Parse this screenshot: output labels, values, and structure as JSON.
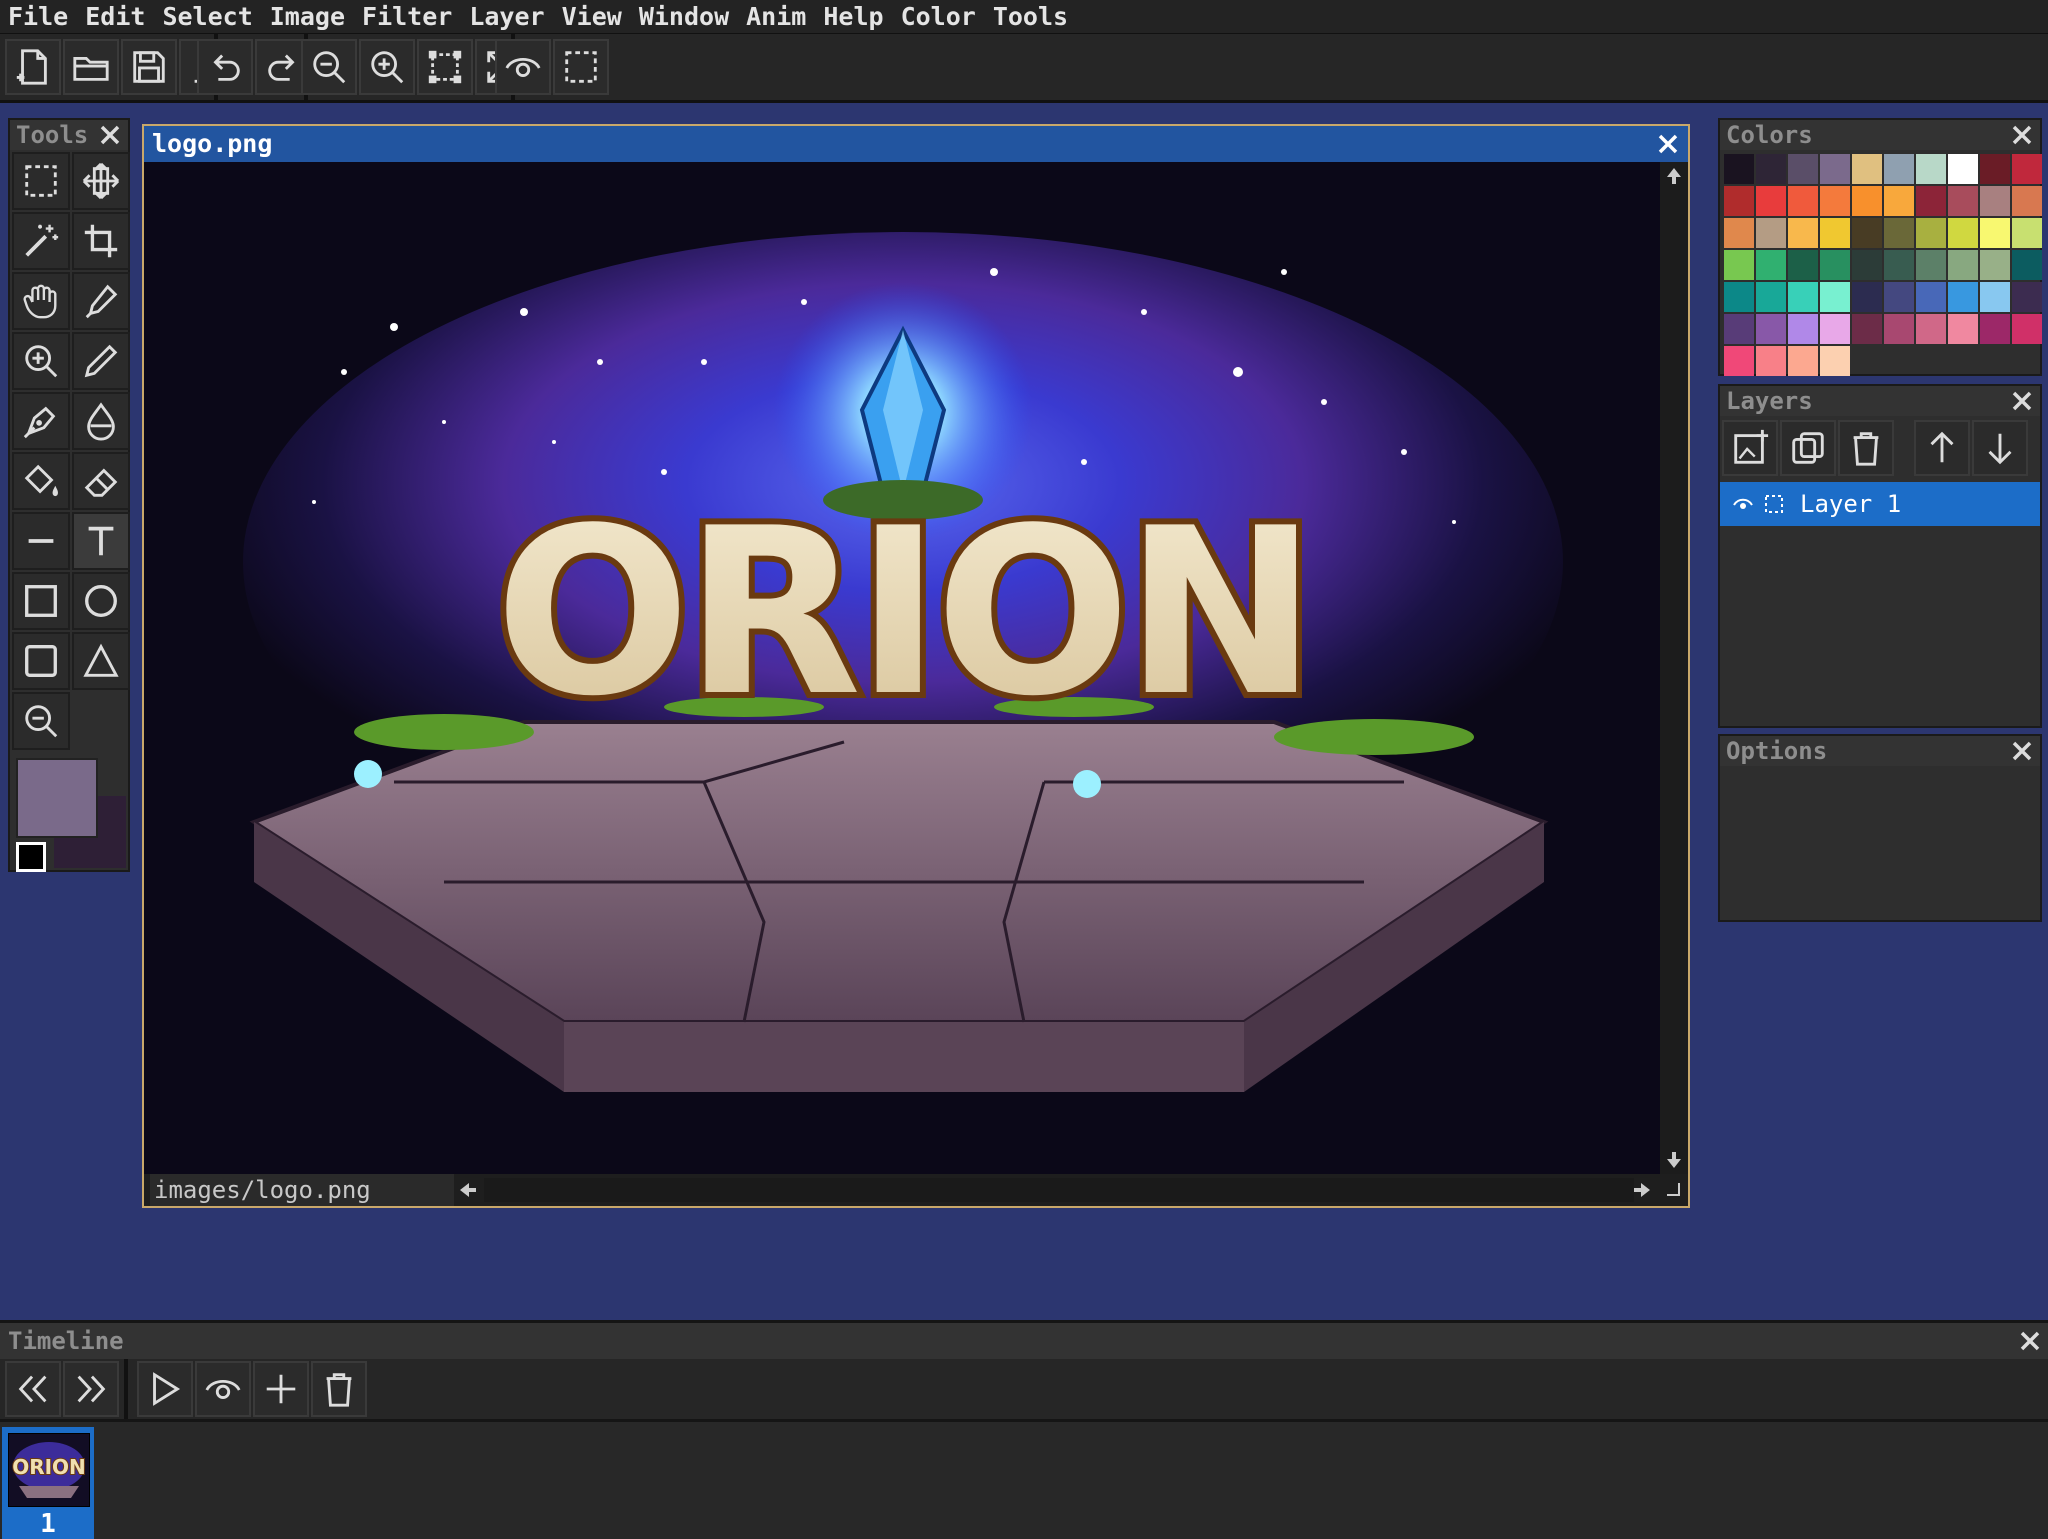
{
  "menu": [
    "File",
    "Edit",
    "Select",
    "Image",
    "Filter",
    "Layer",
    "View",
    "Window",
    "Anim",
    "Help",
    "Color",
    "Tools"
  ],
  "toolbar": {
    "groups": [
      [
        "new-file-icon",
        "open-folder-icon",
        "save-icon",
        "download-icon"
      ],
      [
        "undo-icon",
        "redo-icon"
      ],
      [
        "zoom-out-icon",
        "zoom-in-icon",
        "fit-canvas-icon",
        "fullscreen-icon"
      ],
      [
        "preview-eye-icon",
        "selection-marquee-icon"
      ]
    ]
  },
  "tools_panel": {
    "title": "Tools",
    "tools": [
      "rect-select-icon",
      "move-icon",
      "magic-wand-icon",
      "crop-icon",
      "hand-icon",
      "eyedropper-icon",
      "zoom-icon",
      "pencil-icon",
      "pen-icon",
      "blur-drop-icon",
      "bucket-fill-icon",
      "eraser-icon",
      "line-icon",
      "text-icon",
      "rectangle-icon",
      "ellipse-icon",
      "rounded-rect-icon",
      "triangle-icon",
      "zoom-out-tool-icon"
    ],
    "active_tool": "text-icon",
    "primary_color": "#7a6a8a",
    "secondary_color": "#2e1f36"
  },
  "document": {
    "title": "logo.png",
    "status_path": "images/logo.png",
    "canvas_title_text": "ORION"
  },
  "colors_panel": {
    "title": "Colors",
    "palette": [
      "#1a1320",
      "#2e2536",
      "#5a4e68",
      "#7b6a8c",
      "#e0c080",
      "#8fa0b0",
      "#b8d8c8",
      "#ffffff",
      "#6a1c26",
      "#c0283c",
      "#b02c2c",
      "#e83c3c",
      "#f05a3c",
      "#f47a3c",
      "#f8902c",
      "#f8a83c",
      "#8c2438",
      "#a84c5c",
      "#a88080",
      "#d87850",
      "#e0884c",
      "#b49c84",
      "#f8b84c",
      "#f0c830",
      "#483c24",
      "#6a6838",
      "#a8b040",
      "#d0d840",
      "#f8f870",
      "#c8e070",
      "#78c850",
      "#30b070",
      "#1c6048",
      "#289060",
      "#2c3c38",
      "#385c50",
      "#5c8068",
      "#88a880",
      "#98b088",
      "#0c5c60",
      "#0c8888",
      "#18a898",
      "#38d0b8",
      "#78f0d0",
      "#2c2c50",
      "#444880",
      "#4868b8",
      "#3898e0",
      "#88c8f0",
      "#3c2c50",
      "#583c78",
      "#8858a8",
      "#b088e8",
      "#e8a8e8",
      "#6c2c48",
      "#a84870",
      "#d06888",
      "#f088a0",
      "#9c2868",
      "#d03068",
      "#f04878",
      "#f88088",
      "#fca890",
      "#fcd0b0"
    ]
  },
  "layers_panel": {
    "title": "Layers",
    "buttons": [
      "add-layer-icon",
      "duplicate-layer-icon",
      "delete-layer-icon",
      "move-layer-up-icon",
      "move-layer-down-icon"
    ],
    "layers": [
      {
        "name": "Layer 1",
        "visible": true,
        "selected": true
      }
    ]
  },
  "options_panel": {
    "title": "Options"
  },
  "timeline": {
    "title": "Timeline",
    "buttons": [
      "first-frame-icon",
      "last-frame-icon",
      "play-icon",
      "onion-skin-icon",
      "add-frame-icon",
      "delete-frame-icon"
    ],
    "frames": [
      {
        "number": "1",
        "selected": true
      }
    ]
  }
}
